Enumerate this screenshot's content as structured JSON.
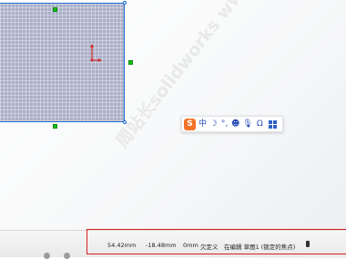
{
  "canvas": {
    "watermark": "周站长solidworks  www.zzzsolidworks.com",
    "colors": {
      "selection": "#1f6bd1",
      "handle": "#1bbf1b",
      "hatch": "#aab0c8"
    }
  },
  "ime_toolbar": {
    "logo": "S",
    "items": [
      {
        "name": "chinese-mode",
        "label": "中"
      },
      {
        "name": "moon-icon",
        "label": "☽"
      },
      {
        "name": "punctuation-icon",
        "label": "°,"
      },
      {
        "name": "emoji-icon",
        "label": "☻"
      },
      {
        "name": "microphone-icon",
        "label": "🎙"
      },
      {
        "name": "headset-icon",
        "label": "Ω"
      }
    ]
  },
  "status_bar": {
    "x": "54.42mm",
    "y": "-18.48mm",
    "z": "0mm",
    "definition": "欠定义",
    "editing": "在编辑 草图1 (锁定的焦点)",
    "accent": "#d92020"
  }
}
